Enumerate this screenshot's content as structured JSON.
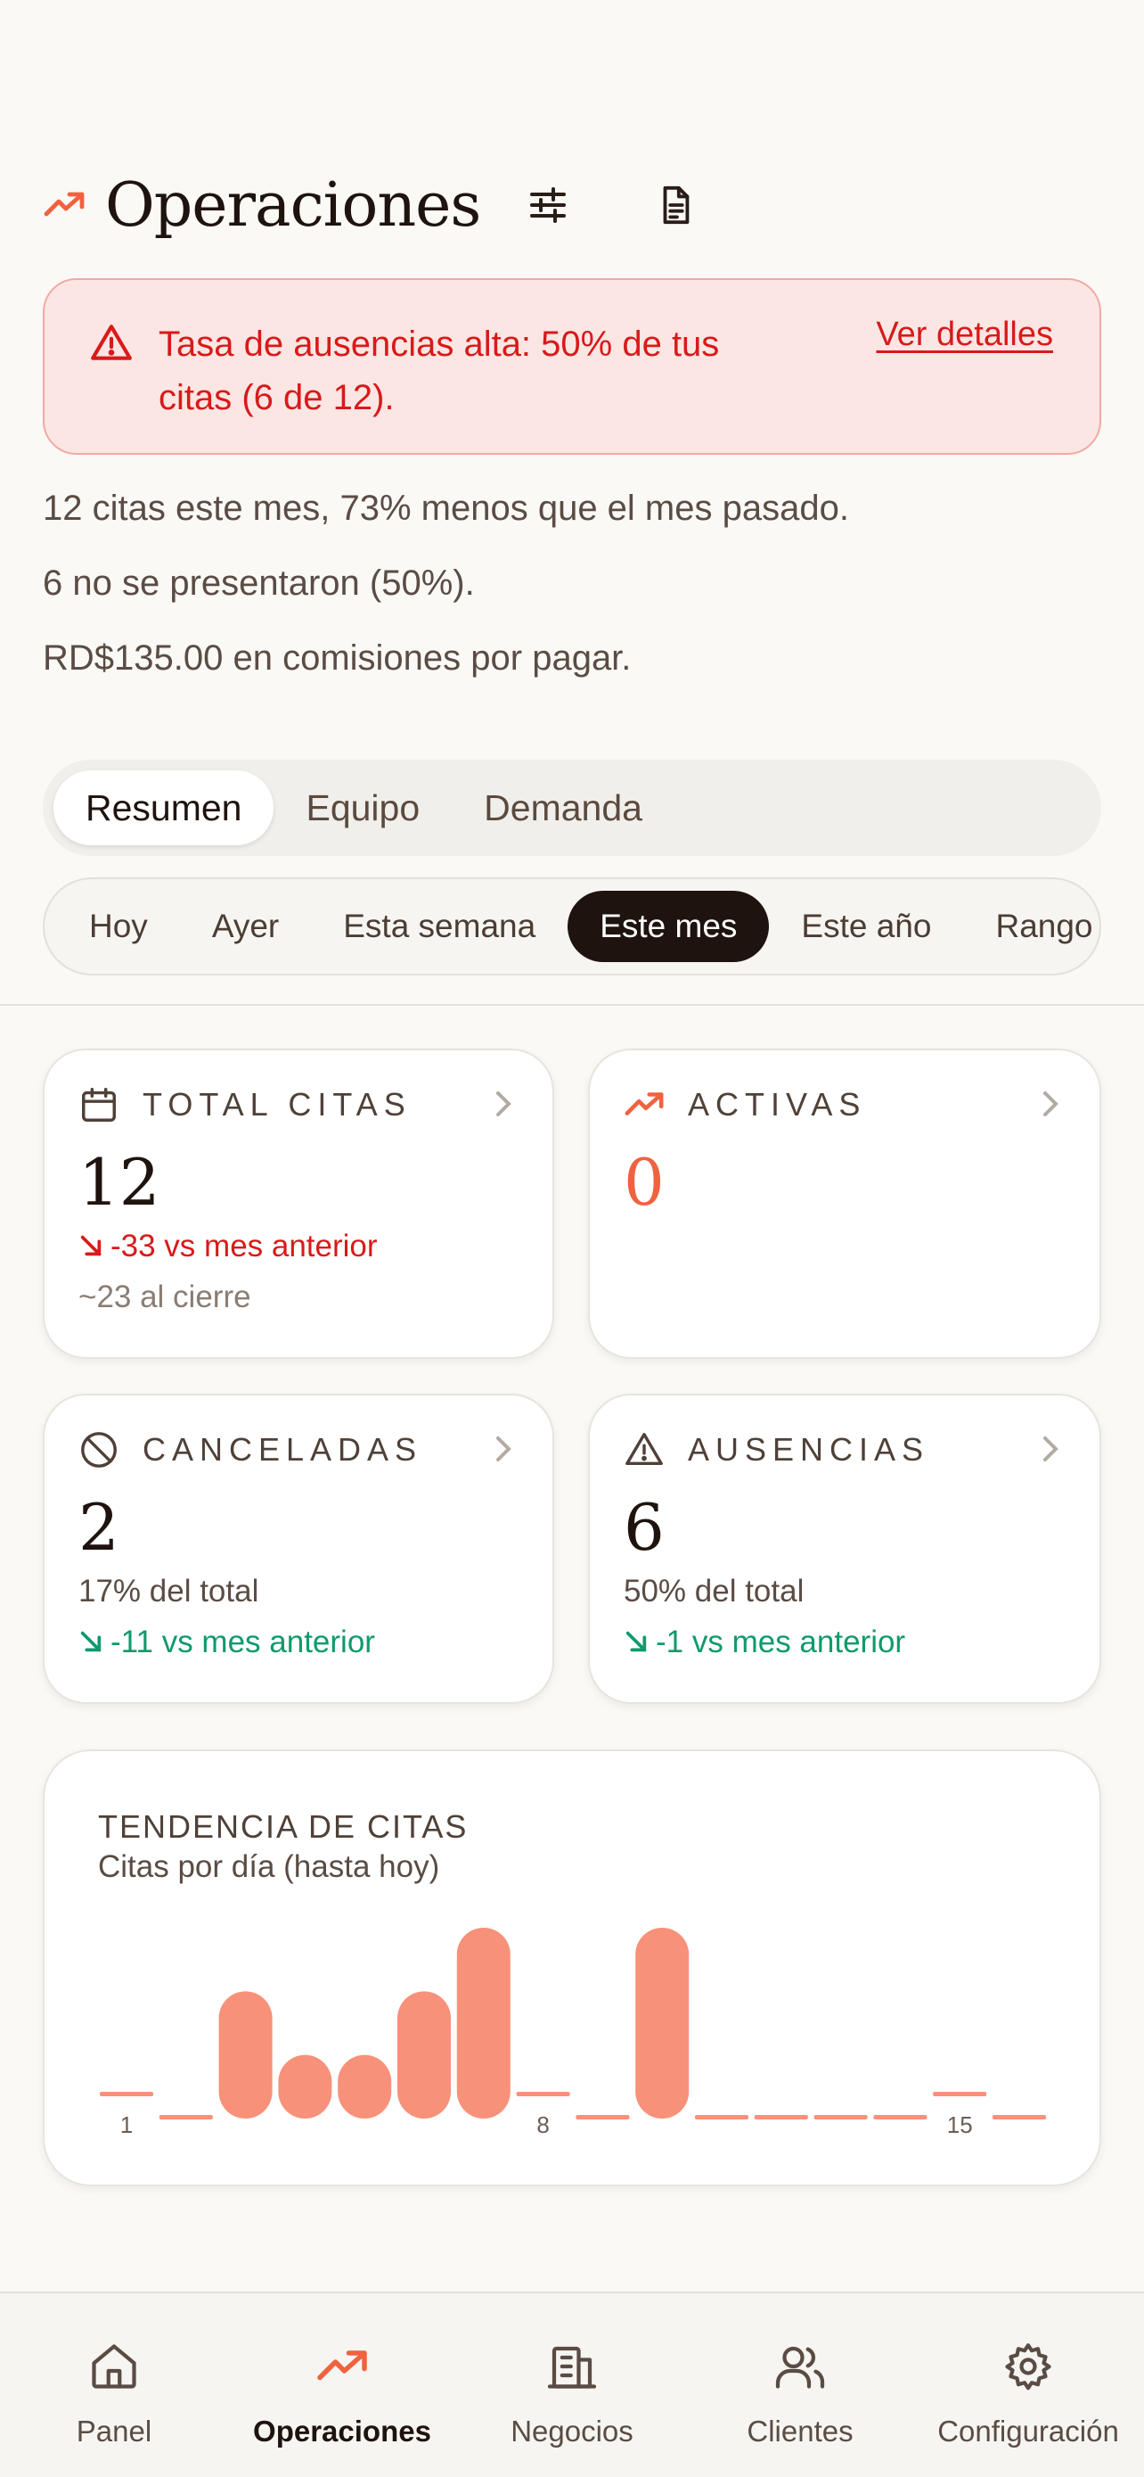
{
  "header": {
    "title": "Operaciones",
    "filter_icon": "sliders-icon",
    "report_icon": "document-icon"
  },
  "alert": {
    "message": "Tasa de ausencias alta: 50% de tus citas (6 de 12).",
    "link": "Ver detalles",
    "color": "#d81a1a"
  },
  "summary": [
    "12 citas este mes, 73% menos que el mes pasado.",
    "6 no se presentaron (50%).",
    "RD$135.00 en comisiones por pagar."
  ],
  "tabs": [
    {
      "label": "Resumen",
      "active": true
    },
    {
      "label": "Equipo",
      "active": false
    },
    {
      "label": "Demanda",
      "active": false
    }
  ],
  "ranges": [
    {
      "label": "Hoy",
      "active": false
    },
    {
      "label": "Ayer",
      "active": false
    },
    {
      "label": "Esta semana",
      "active": false
    },
    {
      "label": "Este mes",
      "active": true
    },
    {
      "label": "Este año",
      "active": false
    },
    {
      "label": "Rango",
      "active": false
    }
  ],
  "stats": {
    "total": {
      "label": "TOTAL CITAS",
      "value": "12",
      "delta": "-33 vs mes anterior",
      "note": "~23 al cierre"
    },
    "active": {
      "label": "ACTIVAS",
      "value": "0"
    },
    "canceled": {
      "label": "CANCELADAS",
      "value": "2",
      "share": "17% del total",
      "delta": "-11 vs mes anterior"
    },
    "noshow": {
      "label": "AUSENCIAS",
      "value": "6",
      "share": "50% del total",
      "delta": "-1 vs mes anterior"
    }
  },
  "chart": {
    "title": "TENDENCIA DE CITAS",
    "subtitle": "Citas por día (hasta hoy)",
    "bar_color": "#f7917a"
  },
  "chart_data": {
    "type": "bar",
    "categories": [
      "1",
      "2",
      "3",
      "4",
      "5",
      "6",
      "7",
      "8",
      "9",
      "10",
      "11",
      "12",
      "13",
      "14",
      "15",
      "16"
    ],
    "values": [
      0,
      0,
      2,
      1,
      1,
      2,
      3,
      0,
      0,
      3,
      0,
      0,
      0,
      0,
      0,
      0
    ],
    "x_tick_labels": [
      "1",
      "8",
      "15"
    ],
    "title": "TENDENCIA DE CITAS",
    "subtitle": "Citas por día (hasta hoy)",
    "ylim": [
      0,
      3
    ],
    "grid": false
  },
  "nav": [
    {
      "label": "Panel",
      "icon": "home-icon",
      "active": false
    },
    {
      "label": "Operaciones",
      "icon": "trend-up-icon",
      "active": true
    },
    {
      "label": "Negocios",
      "icon": "building-icon",
      "active": false
    },
    {
      "label": "Clientes",
      "icon": "users-icon",
      "active": false
    },
    {
      "label": "Configuración",
      "icon": "gear-icon",
      "active": false
    }
  ],
  "colors": {
    "accent": "#f0623f",
    "dark": "#1e130e",
    "danger": "#d81a1a",
    "success": "#0f9a6e"
  }
}
